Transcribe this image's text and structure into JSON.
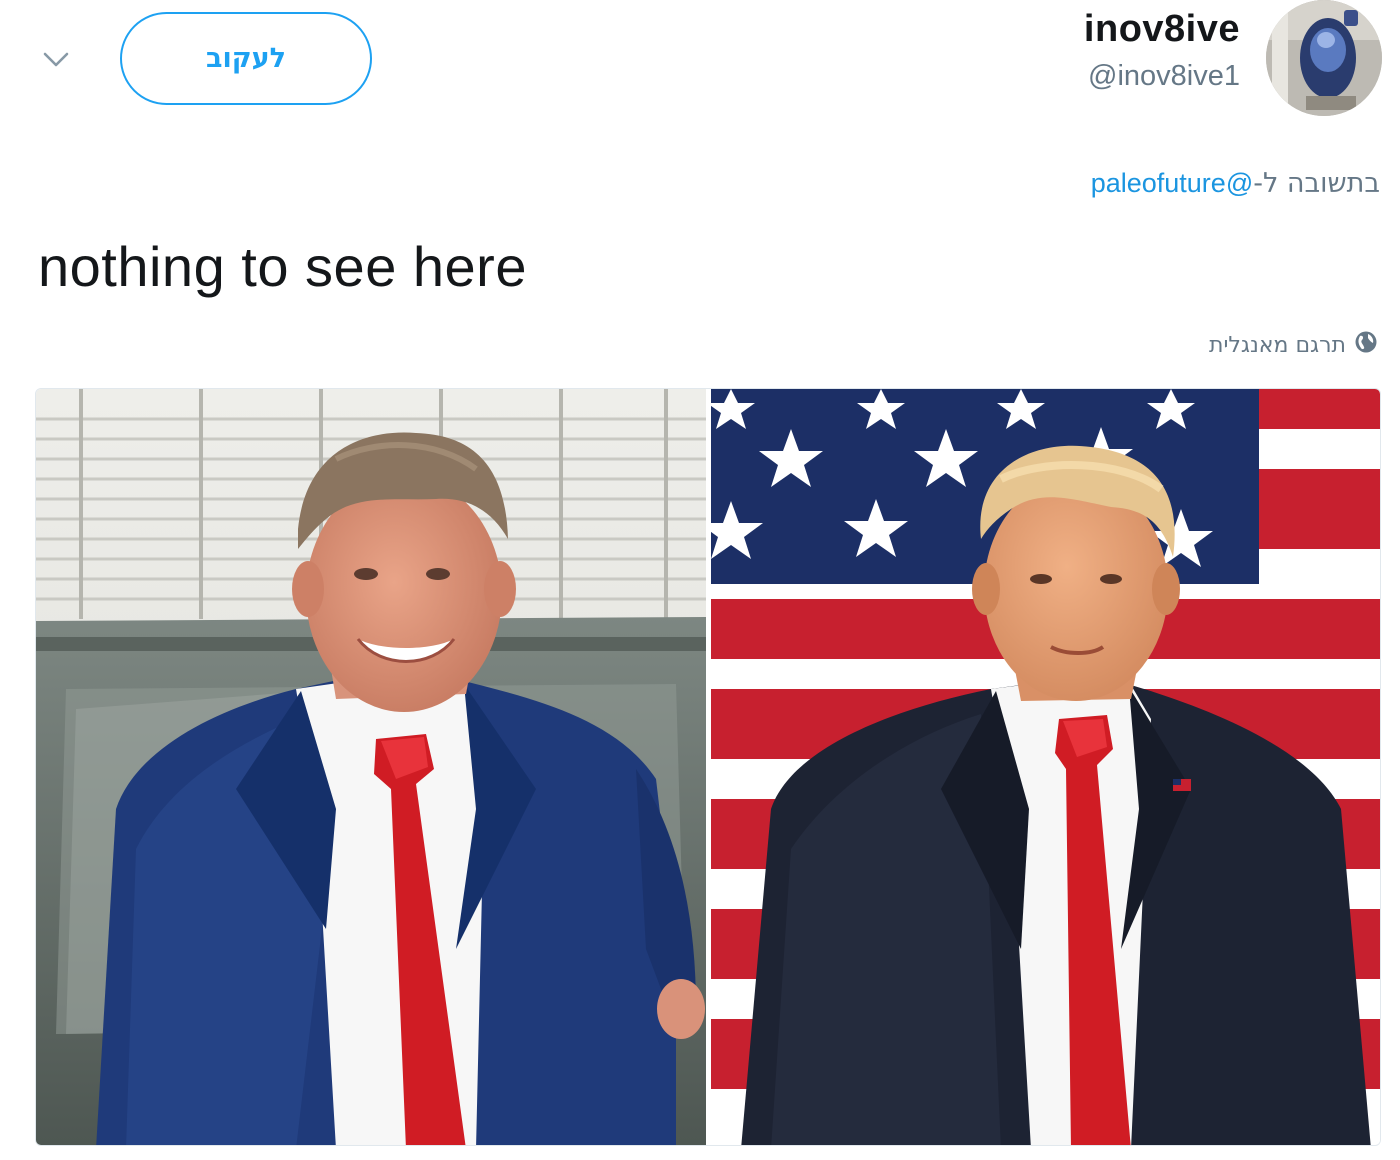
{
  "header": {
    "follow_label": "לעקוב",
    "display_name": "inov8ive",
    "handle": "@inov8ive1"
  },
  "reply": {
    "prefix": "בתשובה ל-",
    "handle": "@paleofuture"
  },
  "tweet": {
    "text": "nothing to see here"
  },
  "translate": {
    "label": "תרגם מאנגלית",
    "icon": "globe-icon"
  },
  "media": {
    "photos": [
      "left-photo-man-in-blue-suit",
      "right-photo-man-before-flag"
    ]
  },
  "colors": {
    "accent": "#1da1f2",
    "link": "#1b95e0",
    "secondary_text": "#657786",
    "suit_blue": "#1f3a7a",
    "tie_red": "#d01c24",
    "flag_red": "#c7202f",
    "flag_blue": "#1c2f66"
  }
}
